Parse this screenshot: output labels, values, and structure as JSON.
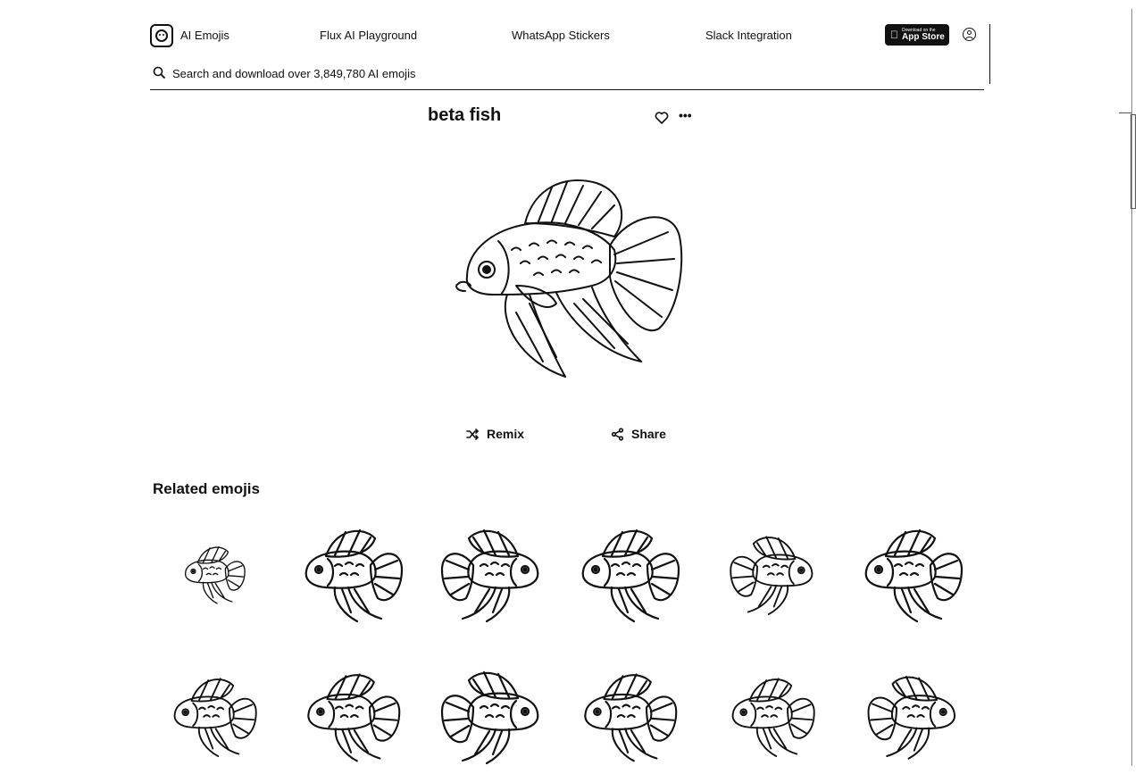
{
  "header": {
    "brand": "AI Emojis",
    "nav": [
      "Flux AI Playground",
      "WhatsApp Stickers",
      "Slack Integration"
    ],
    "appstore_small": "Download on the",
    "appstore_big": "App Store",
    "logo_icon": "smiley-icon",
    "user_icon": "user-icon"
  },
  "search": {
    "placeholder": "Search and download over 3,849,780 AI emojis",
    "value": ""
  },
  "emoji": {
    "title": "beta fish",
    "remix_label": "Remix",
    "share_label": "Share"
  },
  "related": {
    "title": "Related emojis",
    "count": 12
  }
}
